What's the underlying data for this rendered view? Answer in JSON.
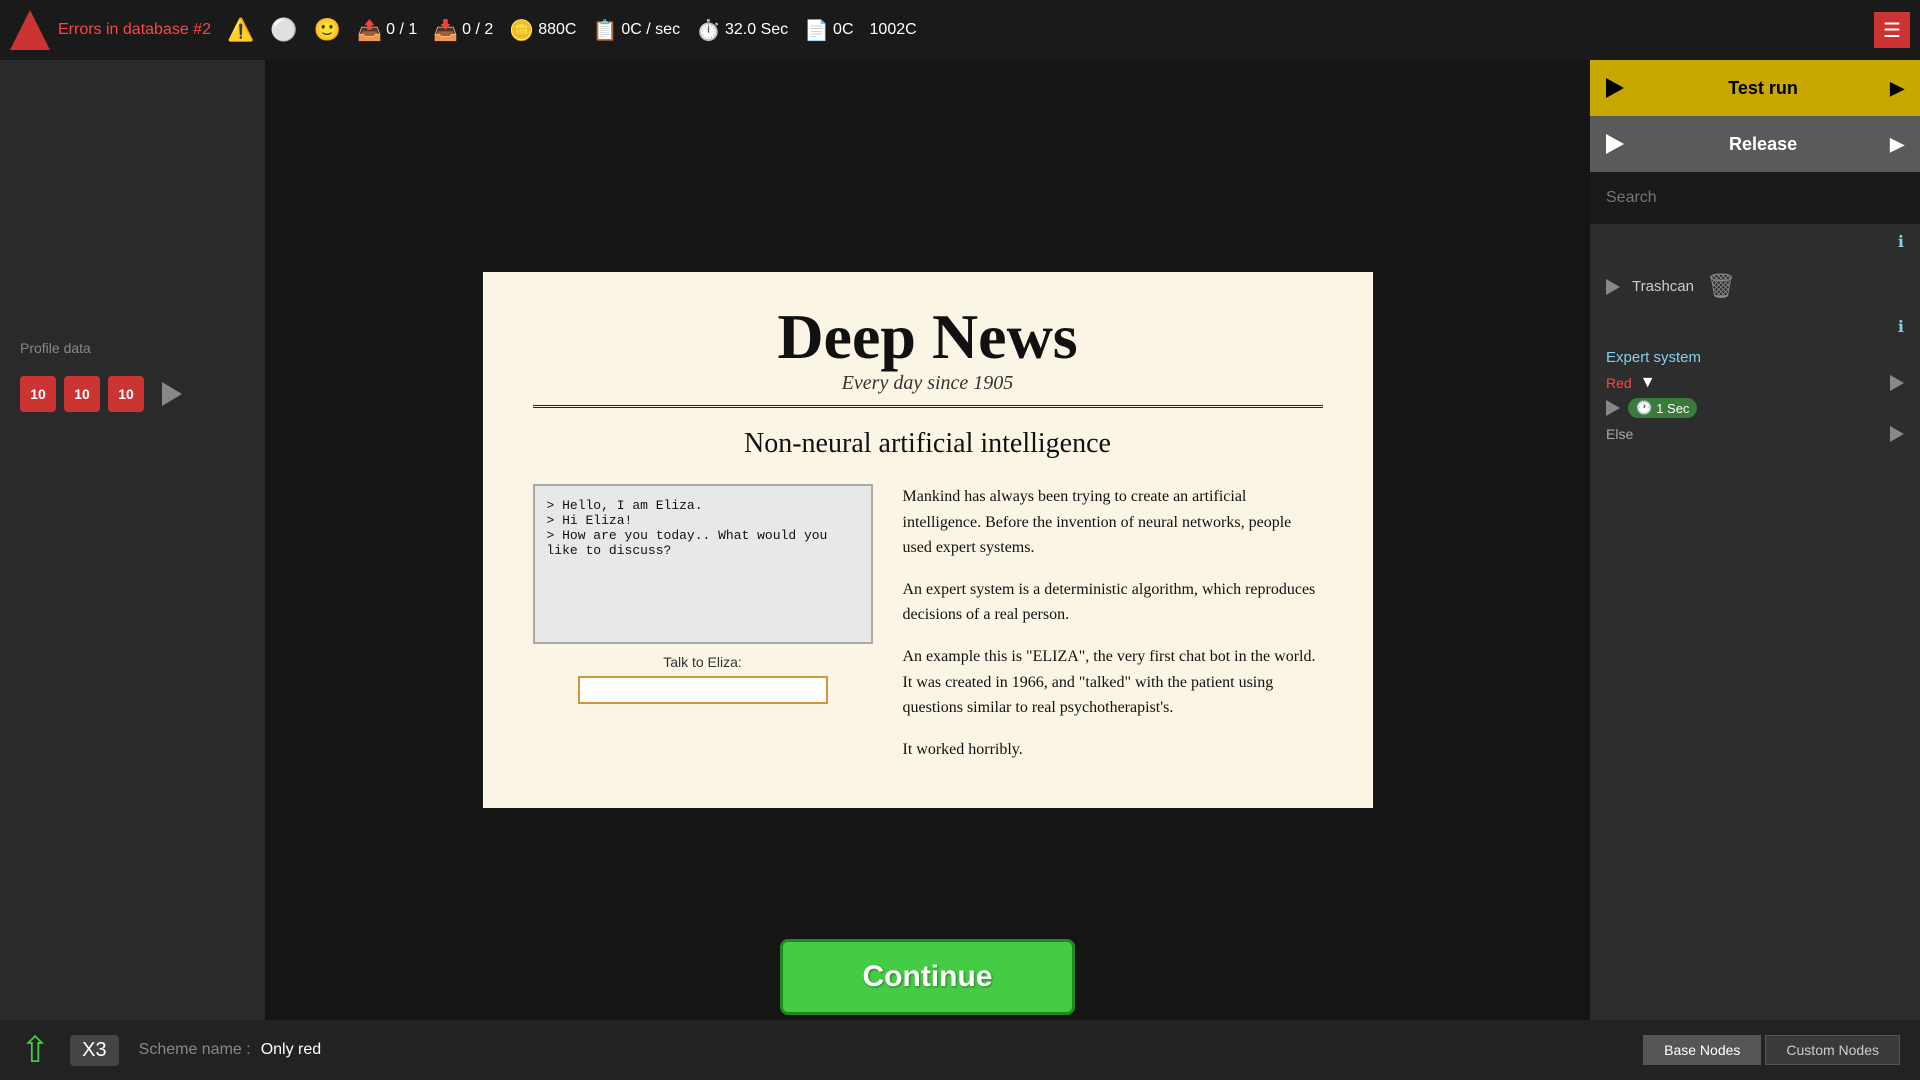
{
  "topbar": {
    "error_label": "Errors in database #2",
    "stat1_count": "0 / 1",
    "stat2_count": "0 / 2",
    "coins": "880",
    "coins_unit": "C",
    "rate": "0",
    "rate_unit": "C / sec",
    "timer": "32.0 Sec",
    "extra_coins": "0",
    "extra_unit": "C",
    "total": "1002",
    "total_unit": "C"
  },
  "right_sidebar": {
    "testrun_label": "Test run",
    "release_label": "Release",
    "search_placeholder": "Search",
    "trashcan_label": "Trashcan",
    "expert_system_label": "Expert system",
    "expert_color": "Red",
    "expert_timer": "1 Sec",
    "else_label": "Else"
  },
  "left_sidebar": {
    "profile_label": "Profile data",
    "node1_value": "10",
    "node2_value": "10",
    "node3_value": "10"
  },
  "newspaper": {
    "title": "Deep News",
    "subtitle": "Every day since 1905",
    "article_title": "Non-neural artificial intelligence",
    "eliza_lines": [
      "> Hello, I am Eliza.",
      "> Hi Eliza!",
      "> How are you today.. What would you like to discuss?"
    ],
    "talk_label": "Talk to Eliza:",
    "talk_input_placeholder": "",
    "body_paragraphs": [
      "Mankind has always been trying to create an artificial intelligence. Before the invention of neural networks, people used expert systems.",
      " An expert system is a deterministic algorithm, which reproduces decisions of a real person.",
      "An example this is \"ELIZA\", the very first chat bot in the world. It was created in 1966, and \"talked\" with the patient using questions similar to real psychotherapist's.",
      "It worked horribly."
    ]
  },
  "bottom": {
    "x3_label": "X3",
    "scheme_name_label": "Scheme name :",
    "scheme_name_value": "Only red",
    "tab1_label": "Base Nodes",
    "tab2_label": "Custom Nodes"
  },
  "continue_button": {
    "label": "Continue"
  }
}
